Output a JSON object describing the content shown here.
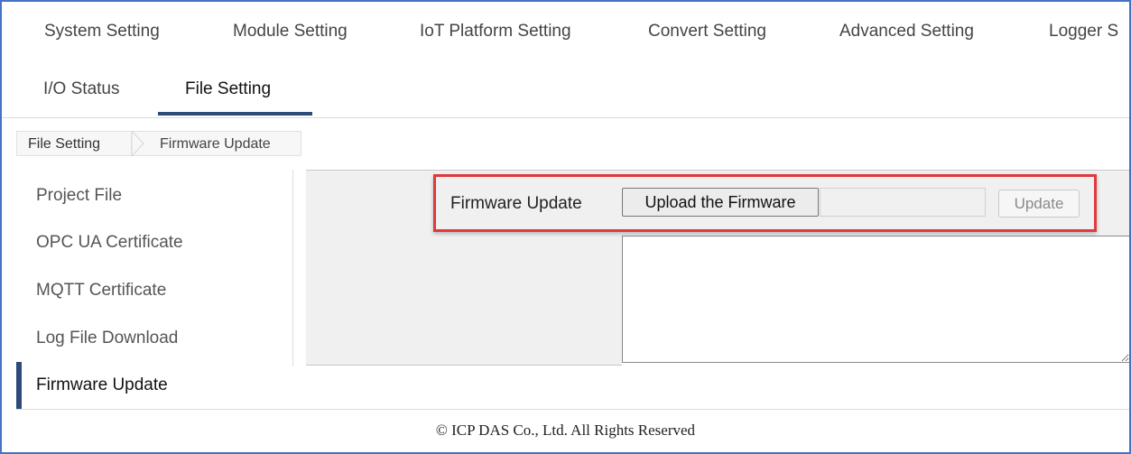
{
  "nav": {
    "row1": [
      "System Setting",
      "Module Setting",
      "IoT Platform Setting",
      "Convert Setting",
      "Advanced Setting",
      "Logger S"
    ],
    "row2": [
      "I/O Status",
      "File Setting"
    ],
    "active_tab": "File Setting"
  },
  "breadcrumb": [
    "File Setting",
    "Firmware Update"
  ],
  "sidebar": {
    "items": [
      "Project File",
      "OPC UA Certificate",
      "MQTT Certificate",
      "Log File Download",
      "Firmware Update"
    ],
    "active": "Firmware Update"
  },
  "main": {
    "label": "Firmware Update",
    "upload_button": "Upload the Firmware",
    "file_value": "",
    "update_button": "Update",
    "log_text": ""
  },
  "footer": "© ICP DAS Co., Ltd. All Rights Reserved",
  "colors": {
    "accent": "#2e4a7a",
    "highlight": "#e0393e",
    "frame": "#4472c4"
  }
}
